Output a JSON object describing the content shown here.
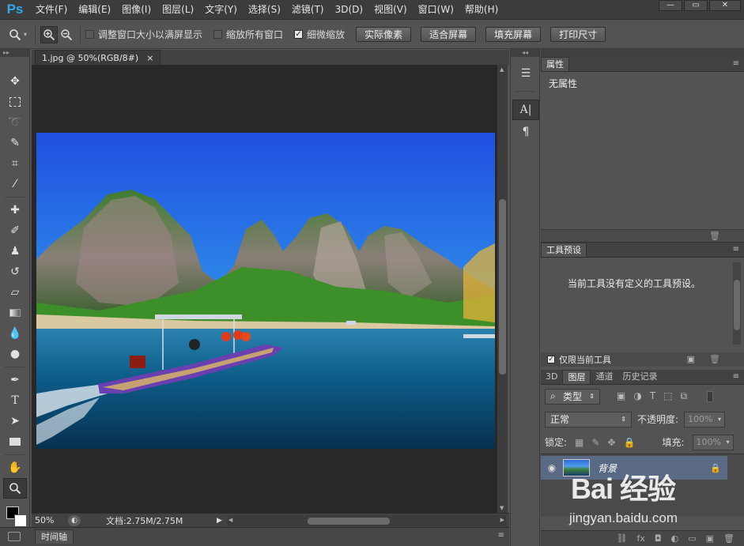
{
  "app": {
    "logo": "Ps"
  },
  "menu": [
    "文件(F)",
    "编辑(E)",
    "图像(I)",
    "图层(L)",
    "文字(Y)",
    "选择(S)",
    "滤镜(T)",
    "3D(D)",
    "视图(V)",
    "窗口(W)",
    "帮助(H)"
  ],
  "window_controls": {
    "minimize": "—",
    "restore": "▭",
    "close": "✕"
  },
  "options": {
    "tool_icon": "zoom-tool-icon",
    "zoom_in_icon": "zoom-in-icon",
    "zoom_out_icon": "zoom-out-icon",
    "checks": [
      {
        "label": "调整窗口大小以满屏显示",
        "checked": false
      },
      {
        "label": "缩放所有窗口",
        "checked": false
      },
      {
        "label": "细微缩放",
        "checked": true
      }
    ],
    "buttons": [
      "实际像素",
      "适合屏幕",
      "填充屏幕",
      "打印尺寸"
    ]
  },
  "document": {
    "tab_title": "1.jpg @ 50%(RGB/8#)",
    "tab_close": "×",
    "zoom": "50%",
    "info": "文档:2.75M/2.75M"
  },
  "timeline": {
    "label": "时间轴"
  },
  "panels": {
    "properties": {
      "title": "属性",
      "body": "无属性"
    },
    "tool_presets": {
      "title": "工具预设",
      "body": "当前工具没有定义的工具预设。",
      "current_only_label": "仅限当前工具",
      "current_only_checked": true
    },
    "layers": {
      "tabs": [
        "3D",
        "图层",
        "通道",
        "历史记录"
      ],
      "active_tab": "图层",
      "filter_kind": "类型",
      "blend_mode": "正常",
      "opacity_label": "不透明度:",
      "opacity_value": "100%",
      "lock_label": "锁定:",
      "fill_label": "填充:",
      "fill_value": "100%",
      "layer_name": "背景"
    }
  },
  "watermark": {
    "logo": "Bai 经验",
    "url": "jingyan.baidu.com"
  },
  "colors": {
    "ps_blue": "#2fa6f0",
    "ui_dark": "#535353",
    "selected_layer": "#5a6a84"
  }
}
